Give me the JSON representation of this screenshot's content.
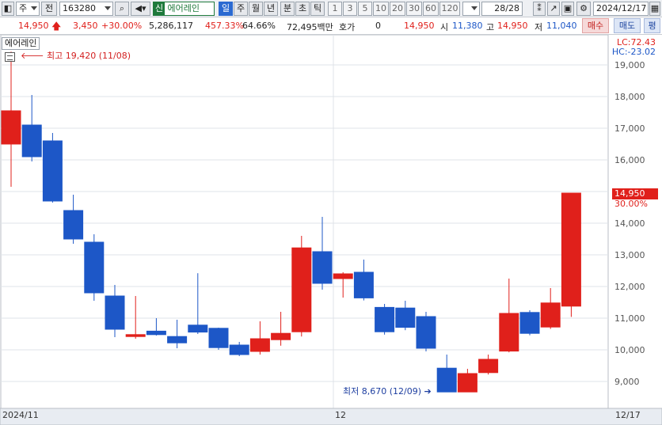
{
  "toolbar": {
    "type_label": "주",
    "prefix_label": "전",
    "code": "163280",
    "badge": "신",
    "name": "에어레인",
    "periods": [
      "일",
      "주",
      "월",
      "년",
      "분",
      "초",
      "틱"
    ],
    "minutes": [
      "1",
      "3",
      "5",
      "10",
      "20",
      "30",
      "60",
      "120"
    ],
    "count": "28/28",
    "date": "2024/12/17"
  },
  "quote": {
    "price": "14,950",
    "change": "3,450",
    "change_pct": "+30.00%",
    "volume": "5,286,117",
    "vol_ratio": "457.33%",
    "turnover": "64.66%",
    "amount": "72,495백만",
    "hoga_label": "호가",
    "hoga_value": "0",
    "ask": "14,950",
    "open_label": "시",
    "open": "11,380",
    "high_label": "고",
    "high": "14,950",
    "low_label": "저",
    "low": "11,040",
    "buy_label": "매수",
    "sell_label": "매도",
    "eval_label": "평"
  },
  "chart": {
    "name_box": "에어레인",
    "high_annotation": "최고 19,420 (11/08)",
    "low_annotation": "최저 8,670 (12/09)",
    "lc": "LC:72.43",
    "hc": "HC:-23.02",
    "last_price": "14,950",
    "last_pct": "30.00%",
    "x_left": "2024/11",
    "x_mid": "12",
    "x_right": "12/17"
  },
  "chart_data": {
    "type": "candlestick",
    "ylim": [
      8500,
      19800
    ],
    "yticks": [
      "19,000",
      "18,000",
      "17,000",
      "16,000",
      "15,000",
      "14,000",
      "13,000",
      "12,000",
      "11,000",
      "10,000",
      "9,000"
    ],
    "ytick_values": [
      19000,
      18000,
      17000,
      16000,
      15000,
      14000,
      13000,
      12000,
      11000,
      10000,
      9000
    ],
    "candles": [
      {
        "o": 16500,
        "h": 19420,
        "l": 15150,
        "c": 17550
      },
      {
        "o": 17100,
        "h": 18050,
        "l": 15950,
        "c": 16100
      },
      {
        "o": 16600,
        "h": 16850,
        "l": 14650,
        "c": 14700
      },
      {
        "o": 14400,
        "h": 14900,
        "l": 13350,
        "c": 13500
      },
      {
        "o": 13400,
        "h": 13650,
        "l": 11550,
        "c": 11800
      },
      {
        "o": 11700,
        "h": 12050,
        "l": 10400,
        "c": 10650
      },
      {
        "o": 10420,
        "h": 11700,
        "l": 10350,
        "c": 10480
      },
      {
        "o": 10590,
        "h": 11000,
        "l": 10450,
        "c": 10480
      },
      {
        "o": 10420,
        "h": 10950,
        "l": 10050,
        "c": 10220
      },
      {
        "o": 10780,
        "h": 12420,
        "l": 10500,
        "c": 10560
      },
      {
        "o": 10680,
        "h": 10700,
        "l": 10000,
        "c": 10070
      },
      {
        "o": 10150,
        "h": 10250,
        "l": 9800,
        "c": 9850
      },
      {
        "o": 9950,
        "h": 10900,
        "l": 9850,
        "c": 10350
      },
      {
        "o": 10320,
        "h": 11200,
        "l": 10130,
        "c": 10520
      },
      {
        "o": 10570,
        "h": 13600,
        "l": 10420,
        "c": 13220
      },
      {
        "o": 13100,
        "h": 14200,
        "l": 11900,
        "c": 12100
      },
      {
        "o": 12250,
        "h": 12450,
        "l": 11650,
        "c": 12400
      },
      {
        "o": 12450,
        "h": 12850,
        "l": 11560,
        "c": 11640
      },
      {
        "o": 11340,
        "h": 11450,
        "l": 10480,
        "c": 10570
      },
      {
        "o": 11320,
        "h": 11550,
        "l": 10620,
        "c": 10710
      },
      {
        "o": 11050,
        "h": 11200,
        "l": 9950,
        "c": 10050
      },
      {
        "o": 9420,
        "h": 9850,
        "l": 8670,
        "c": 8670
      },
      {
        "o": 8670,
        "h": 9400,
        "l": 8670,
        "c": 9250
      },
      {
        "o": 9280,
        "h": 9850,
        "l": 9220,
        "c": 9700
      },
      {
        "o": 9960,
        "h": 12250,
        "l": 9920,
        "c": 11150
      },
      {
        "o": 11180,
        "h": 11250,
        "l": 10460,
        "c": 10520
      },
      {
        "o": 10720,
        "h": 11950,
        "l": 10660,
        "c": 11480
      },
      {
        "o": 11380,
        "h": 14950,
        "l": 11040,
        "c": 14950
      }
    ],
    "colors": {
      "up": "#e0201b",
      "down": "#1d57c7"
    }
  }
}
